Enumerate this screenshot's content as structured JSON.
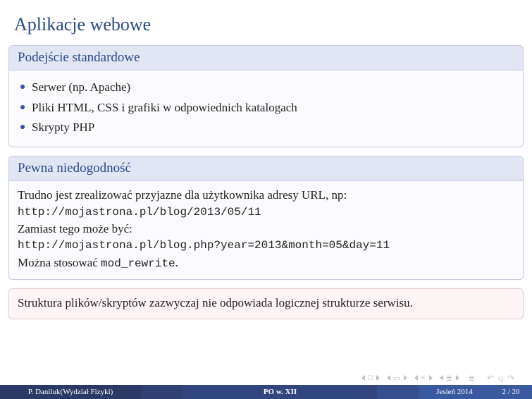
{
  "title": "Aplikacje webowe",
  "block1": {
    "header": "Podejście standardowe",
    "items": [
      "Serwer (np. Apache)",
      "Pliki HTML, CSS i grafiki w odpowiednich katalogach",
      "Skrypty PHP"
    ]
  },
  "block2": {
    "header": "Pewna niedogodność",
    "line1": "Trudno jest zrealizować przyjazne dla użytkownika adresy URL, np:",
    "url1": "http://mojastrona.pl/blog/2013/05/11",
    "line2": "Zamiast tego może być:",
    "url2": "http://mojastrona.pl/blog.php?year=2013&month=05&day=11",
    "line3a": "Można stosować ",
    "line3b": "mod_rewrite",
    "line3c": "."
  },
  "block3": {
    "text": "Struktura plików/skryptów zazwyczaj nie odpowiada logicznej strukturze serwisu."
  },
  "footer": {
    "author": "P. Daniluk(Wydział Fizyki)",
    "short_title": "PO w. XII",
    "date": "Jesień 2014",
    "page": "2 / 20"
  }
}
